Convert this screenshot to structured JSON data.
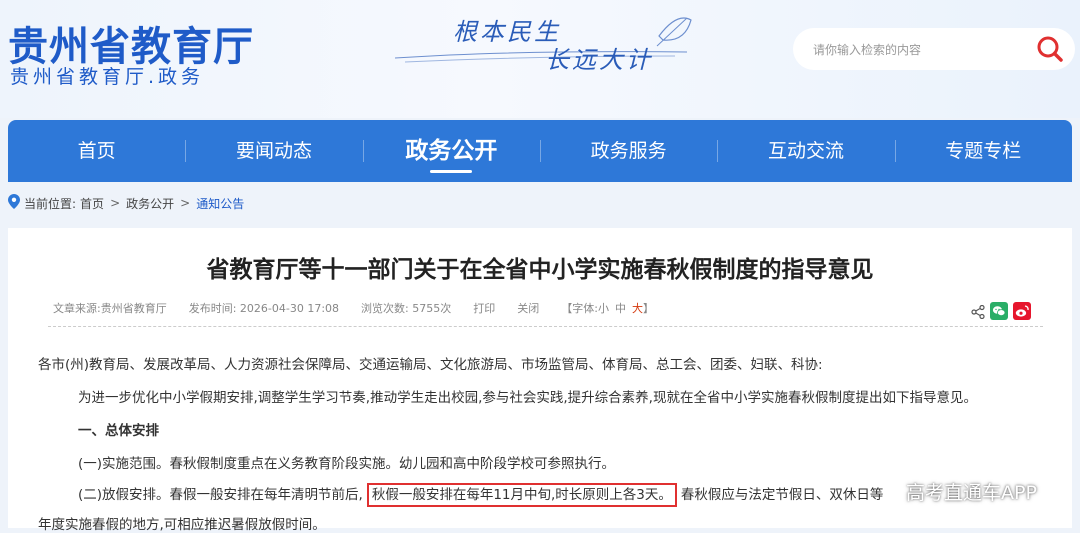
{
  "header": {
    "logo_main": "贵州省教育厅",
    "logo_sub": "贵州省教育厅.政务",
    "slogan_line1": "根本民生",
    "slogan_line2": "长远大计",
    "search": {
      "placeholder": "请你输入检索的内容"
    }
  },
  "nav": {
    "items": [
      {
        "label": "首页"
      },
      {
        "label": "要闻动态"
      },
      {
        "label": "政务公开"
      },
      {
        "label": "政务服务"
      },
      {
        "label": "互动交流"
      },
      {
        "label": "专题专栏"
      }
    ],
    "active_index": 2
  },
  "breadcrumb": {
    "prefix": "当前位置:",
    "items": [
      "首页",
      "政务公开",
      "通知公告"
    ],
    "separator": ">"
  },
  "article": {
    "title": "省教育厅等十一部门关于在全省中小学实施春秋假制度的指导意见",
    "meta": {
      "source": "文章来源:贵州省教育厅",
      "time": "发布时间: 2026-04-30 17:08",
      "views": "浏览次数: 5755次",
      "print": "打印",
      "close": "关闭",
      "font_label": "【字体:",
      "font_small": "小",
      "font_medium": "中",
      "font_large": "大",
      "font_end": "】"
    },
    "body": {
      "salutation": "各市(州)教育局、发展改革局、人力资源社会保障局、交通运输局、文化旅游局、市场监管局、体育局、总工会、团委、妇联、科协:",
      "intro": "为进一步优化中小学假期安排,调整学生学习节奏,推动学生走出校园,参与社会实践,提升综合素养,现就在全省中小学实施春秋假制度提出如下指导意见。",
      "section1": "一、总体安排",
      "item1": "(一)实施范围。春秋假制度重点在义务教育阶段实施。幼儿园和高中阶段学校可参照执行。",
      "item2_before": "(二)放假安排。春假一般安排在每年清明节前后,",
      "item2_highlight": "秋假一般安排在每年11月中旬,时长原则上各3天。",
      "item2_after": "春秋假应与法定节假日、双休日等",
      "item2_cont": "年度实施春假的地方,可相应推迟暑假放假时间。"
    }
  },
  "watermark": "高考直通车APP",
  "colors": {
    "brand": "#1f5bc8",
    "nav": "#2e78d8",
    "highlight_border": "#e03030",
    "wechat": "#2aae67",
    "weibo": "#e6162d"
  }
}
